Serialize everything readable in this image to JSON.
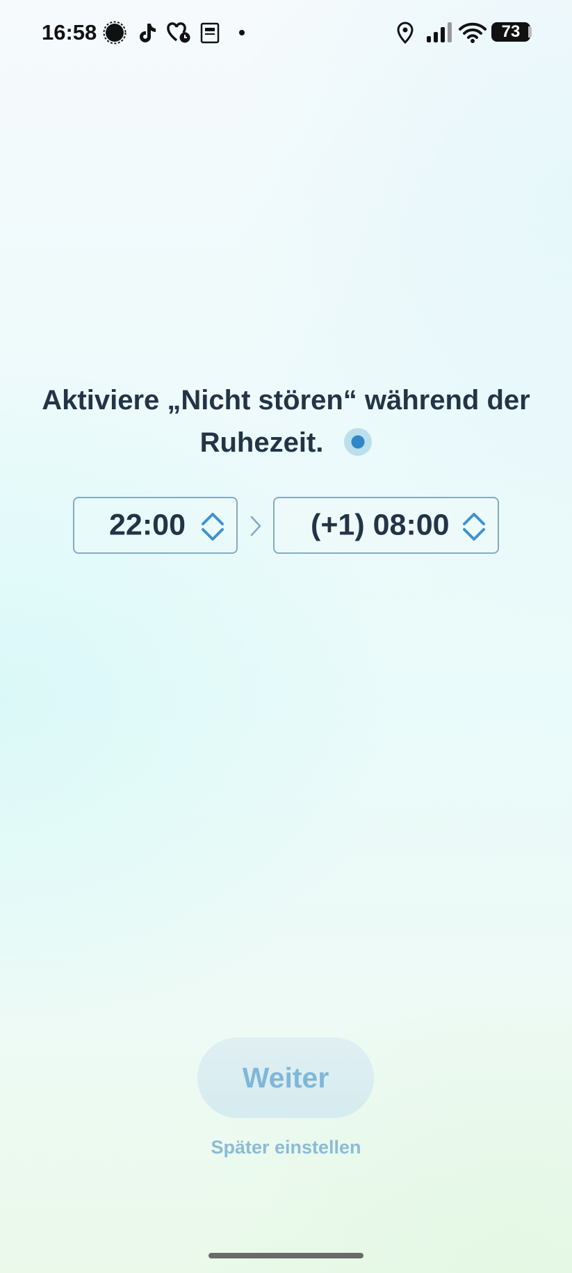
{
  "status_bar": {
    "time": "16:58",
    "notification_icons": [
      "signal-messenger-icon",
      "tiktok-icon",
      "health-heart-clock-icon",
      "calendar-widget-icon",
      "more-dot-icon"
    ],
    "system_icons": [
      "location-icon",
      "cellular-signal-icon",
      "wifi-icon"
    ],
    "battery_level": "73"
  },
  "main": {
    "heading_line1": "Aktiviere „Nicht stören“ während der",
    "heading_line2": "Ruhezeit.",
    "start_time": "22:00",
    "end_time": "(+1) 08:00"
  },
  "actions": {
    "next_label": "Weiter",
    "later_label": "Später einstellen"
  },
  "colors": {
    "text": "#243447",
    "accent": "#2f86c8",
    "button_text": "#7fb7d8",
    "link": "#8cbbd6"
  }
}
